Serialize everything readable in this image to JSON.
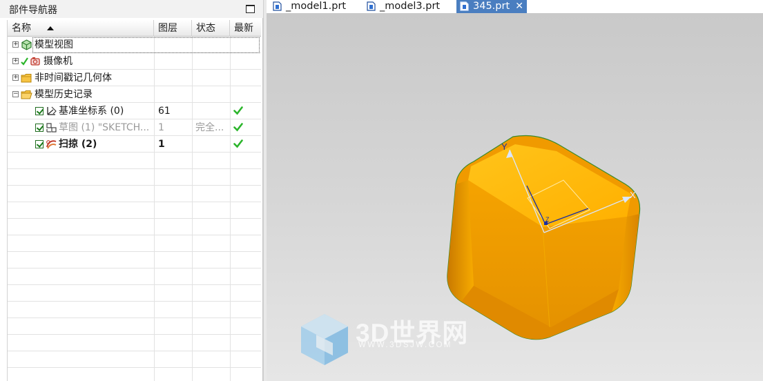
{
  "navigator": {
    "title": "部件导航器",
    "columns": {
      "name": "名称",
      "layer": "图层",
      "status": "状态",
      "latest": "最新"
    },
    "rows": [
      {
        "label": "模型视图",
        "layer": "",
        "status": "",
        "latest": ""
      },
      {
        "label": "摄像机",
        "layer": "",
        "status": "",
        "latest": ""
      },
      {
        "label": "非时间戳记几何体",
        "layer": "",
        "status": "",
        "latest": ""
      },
      {
        "label": "模型历史记录",
        "layer": "",
        "status": "",
        "latest": ""
      },
      {
        "label": "基准坐标系 (0)",
        "layer": "61",
        "status": "",
        "latest": "check"
      },
      {
        "label": "草图 (1) \"SKETCH...",
        "layer": "1",
        "status": "完全...",
        "latest": "check"
      },
      {
        "label": "扫掠 (2)",
        "layer": "1",
        "status": "",
        "latest": "check"
      }
    ]
  },
  "tabs": [
    {
      "label": "_model1.prt",
      "active": false
    },
    {
      "label": "_model3.prt",
      "active": false
    },
    {
      "label": "345.prt",
      "active": true,
      "close": "✕"
    }
  ],
  "viewport": {
    "axis_labels": {
      "x": "X",
      "y": "Y",
      "z": "Z"
    },
    "model_color": "#f7a800"
  },
  "watermark": {
    "text": "3D世界网",
    "url": "WWW.3DSJW.COM"
  },
  "colors": {
    "accent_tab": "#4a7ec0",
    "check_green": "#2bb52b"
  }
}
